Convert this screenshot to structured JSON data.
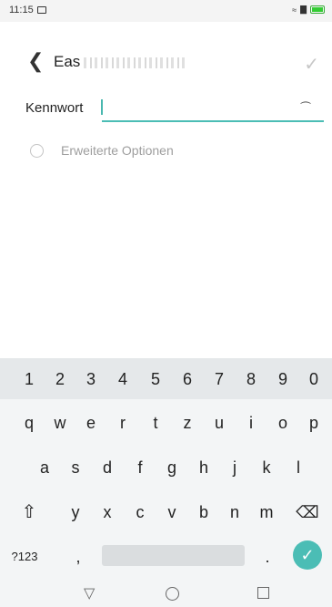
{
  "status_bar": {
    "time": "11:15"
  },
  "header": {
    "title": "Eas"
  },
  "password": {
    "label": "Kennwort",
    "value": ""
  },
  "options": {
    "label": "Erweiterte Optionen"
  },
  "keyboard": {
    "numbers": [
      "1",
      "2",
      "3",
      "4",
      "5",
      "6",
      "7",
      "8",
      "9",
      "0"
    ],
    "row1": [
      "q",
      "w",
      "e",
      "r",
      "t",
      "z",
      "u",
      "i",
      "o",
      "p"
    ],
    "row2": [
      "a",
      "s",
      "d",
      "f",
      "g",
      "h",
      "j",
      "k",
      "l"
    ],
    "row3": [
      "y",
      "x",
      "c",
      "v",
      "b",
      "n",
      "m"
    ],
    "symbols": "?123",
    "comma": ",",
    "period": "."
  }
}
